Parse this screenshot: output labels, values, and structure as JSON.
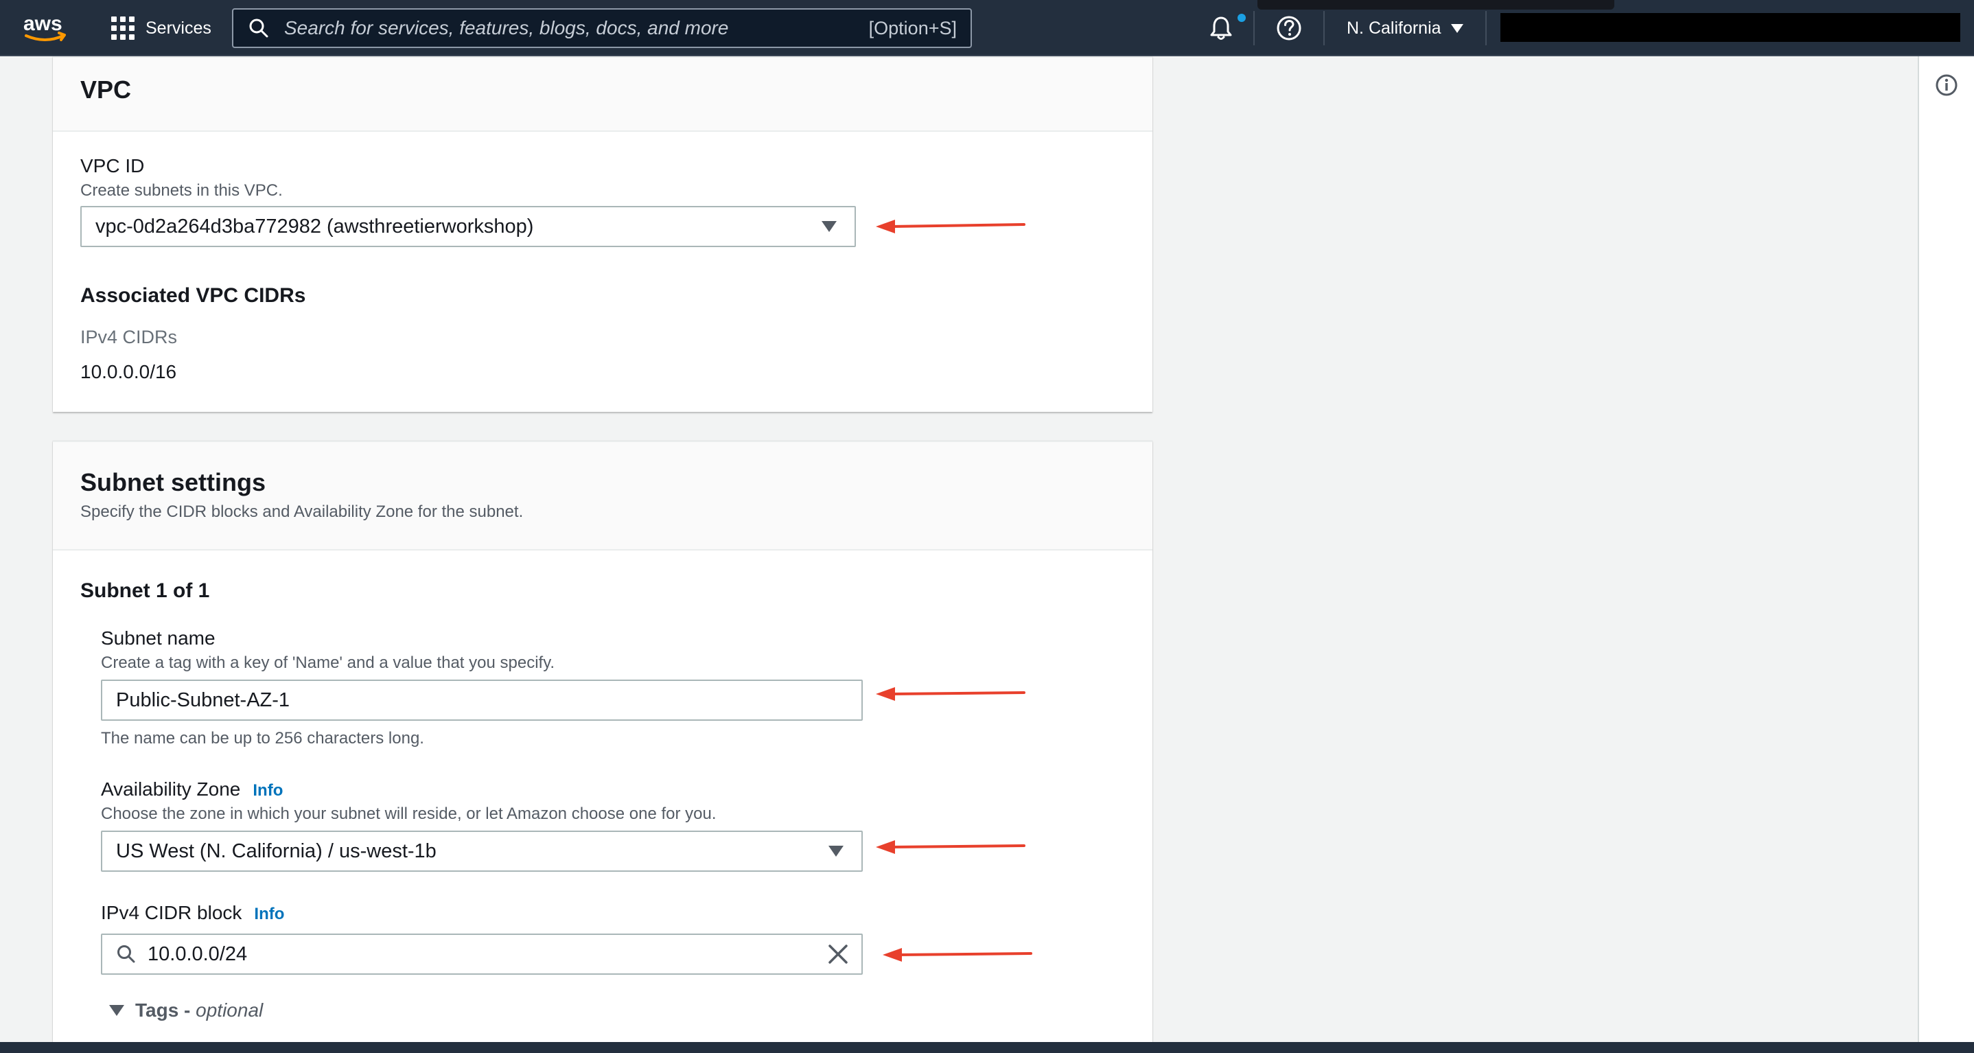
{
  "topnav": {
    "services_label": "Services",
    "search_placeholder": "Search for services, features, blogs, docs, and more",
    "search_shortcut": "[Option+S]",
    "region_label": "N. California",
    "brand_color": "#232f3e",
    "accent_color": "#ff9900",
    "icons": {
      "logo": "aws-logo",
      "services": "grid-icon",
      "search": "search-icon",
      "notifications": "bell-icon",
      "help": "help-icon",
      "region": "caret-down-icon"
    }
  },
  "vpc": {
    "title": "VPC",
    "vpc_id_label": "VPC ID",
    "vpc_id_description": "Create subnets in this VPC.",
    "vpc_id_value": "vpc-0d2a264d3ba772982 (awsthreetierworkshop)",
    "cidrs_heading": "Associated VPC CIDRs",
    "ipv4_cidrs_label": "IPv4 CIDRs",
    "ipv4_cidrs_value": "10.0.0.0/16"
  },
  "subnet_settings": {
    "title": "Subnet settings",
    "description": "Specify the CIDR blocks and Availability Zone for the subnet.",
    "subnet_heading": "Subnet 1 of 1",
    "subnet_name_label": "Subnet name",
    "subnet_name_description": "Create a tag with a key of 'Name' and a value that you specify.",
    "subnet_name_value": "Public-Subnet-AZ-1",
    "subnet_name_hint": "The name can be up to 256 characters long.",
    "az_label": "Availability Zone",
    "az_info": "Info",
    "az_description": "Choose the zone in which your subnet will reside, or let Amazon choose one for you.",
    "az_value": "US West (N. California) / us-west-1b",
    "cidr_label": "IPv4 CIDR block",
    "cidr_info": "Info",
    "cidr_value": "10.0.0.0/24",
    "tags_label": "Tags - ",
    "tags_optional": "optional"
  },
  "annotations": {
    "arrow_color": "#e8402c"
  },
  "link_color": "#0073bb"
}
